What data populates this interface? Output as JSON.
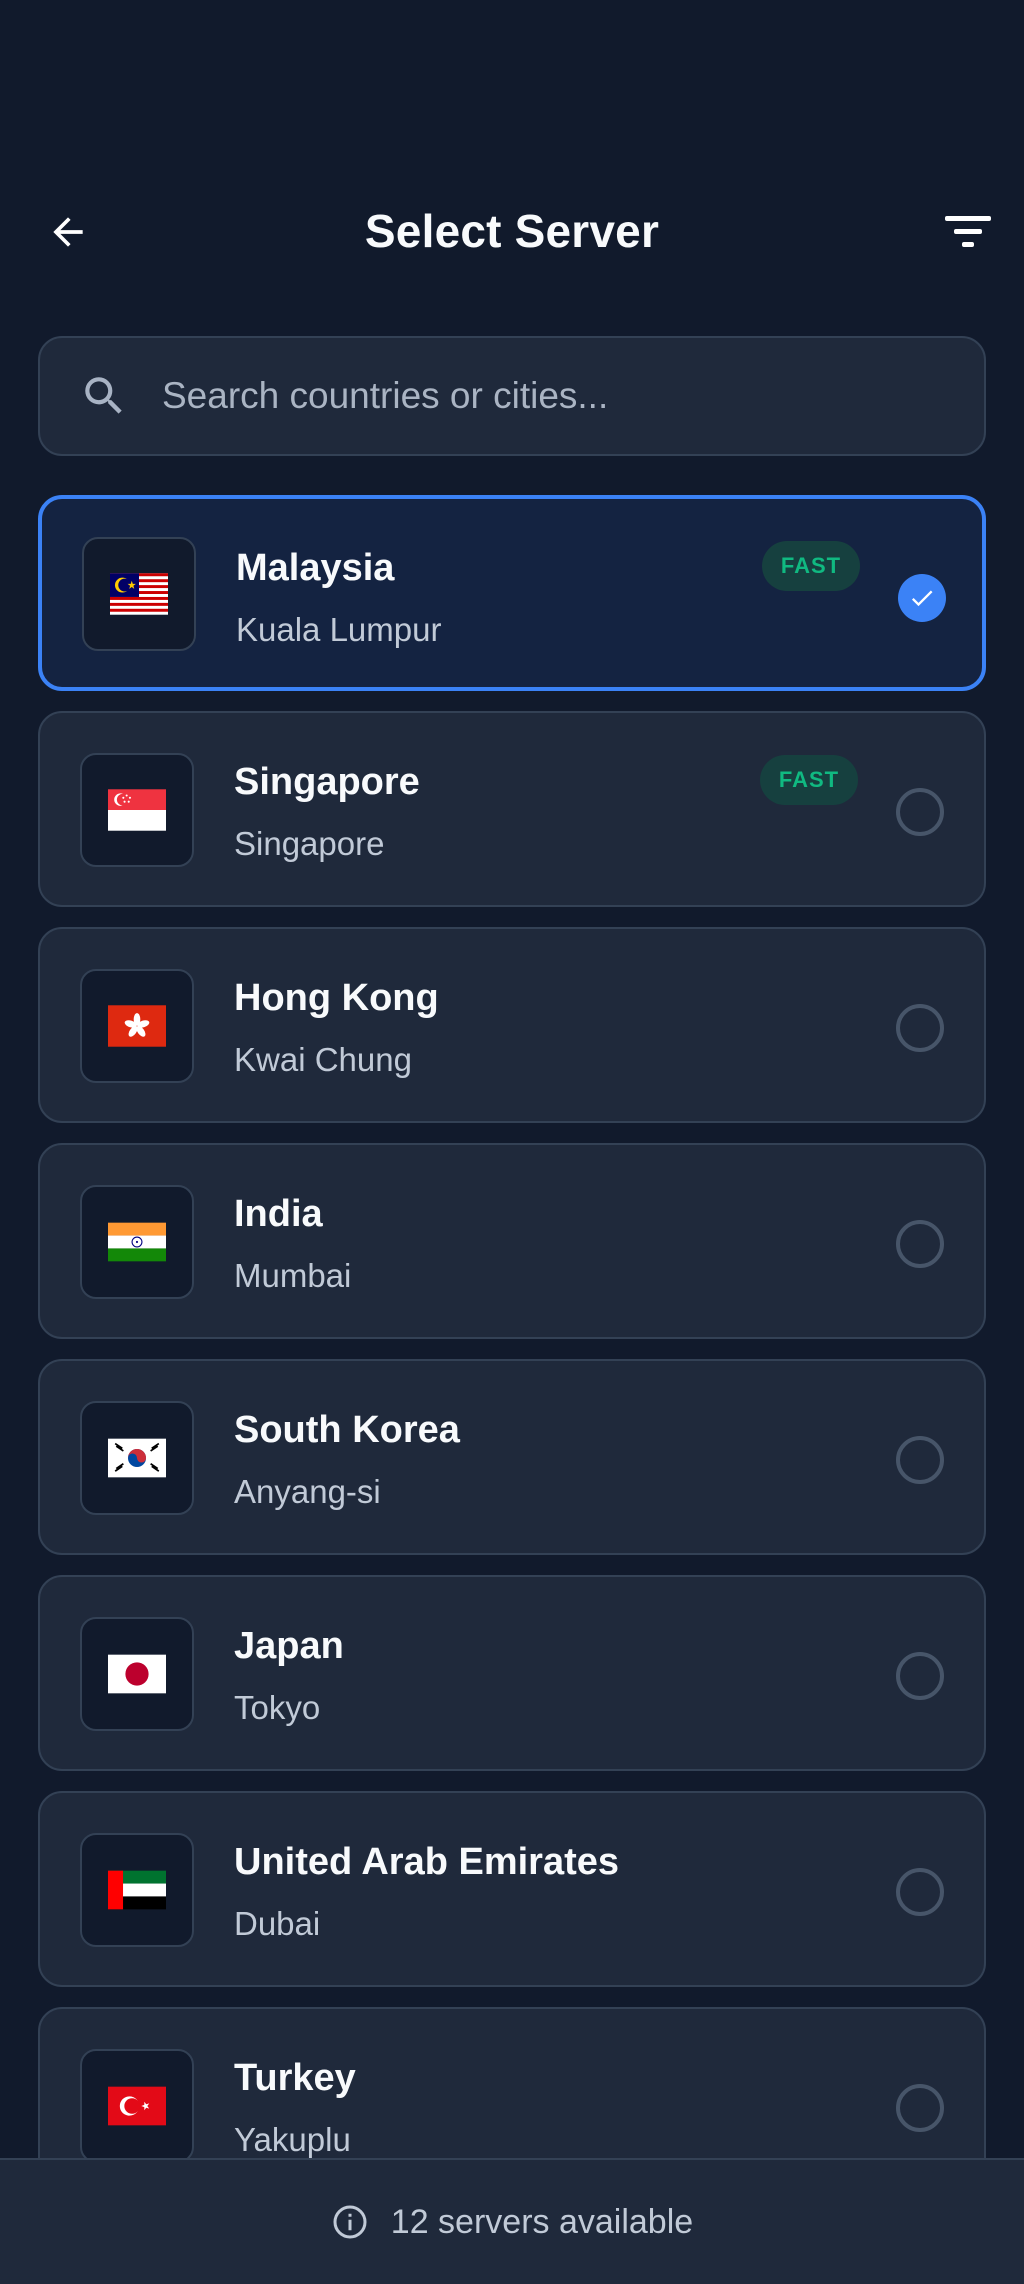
{
  "header": {
    "title": "Select Server",
    "back_icon": "arrow-left-icon",
    "filter_icon": "filter-icon"
  },
  "search": {
    "placeholder": "Search countries or cities...",
    "value": "",
    "icon": "search-icon"
  },
  "servers": [
    {
      "country": "Malaysia",
      "city": "Kuala Lumpur",
      "badge": "FAST",
      "selected": true,
      "flag": "malaysia-flag-icon"
    },
    {
      "country": "Singapore",
      "city": "Singapore",
      "badge": "FAST",
      "selected": false,
      "flag": "singapore-flag-icon"
    },
    {
      "country": "Hong Kong",
      "city": "Kwai Chung",
      "badge": "",
      "selected": false,
      "flag": "hong-kong-flag-icon"
    },
    {
      "country": "India",
      "city": "Mumbai",
      "badge": "",
      "selected": false,
      "flag": "india-flag-icon"
    },
    {
      "country": "South Korea",
      "city": "Anyang-si",
      "badge": "",
      "selected": false,
      "flag": "south-korea-flag-icon"
    },
    {
      "country": "Japan",
      "city": "Tokyo",
      "badge": "",
      "selected": false,
      "flag": "japan-flag-icon"
    },
    {
      "country": "United Arab Emirates",
      "city": "Dubai",
      "badge": "",
      "selected": false,
      "flag": "uae-flag-icon"
    },
    {
      "country": "Turkey",
      "city": "Yakuplu",
      "badge": "",
      "selected": false,
      "flag": "turkey-flag-icon"
    }
  ],
  "footer": {
    "text": "12 servers available",
    "icon": "info-icon"
  },
  "colors": {
    "background": "#111a2c",
    "card": "#1f293b",
    "accent": "#3b82f6",
    "fast_badge": "#10b981"
  }
}
